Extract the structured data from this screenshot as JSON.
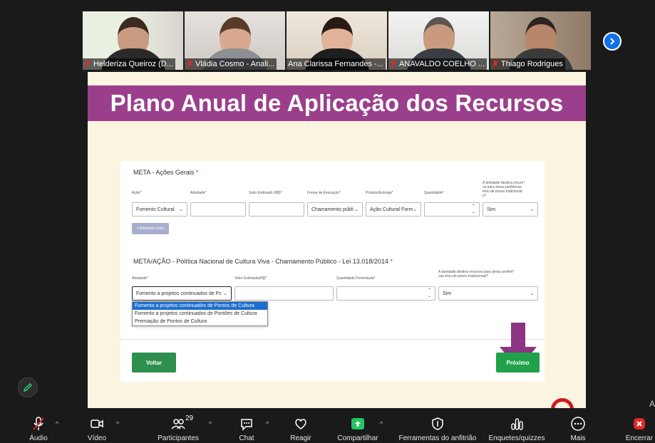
{
  "participants": [
    {
      "name": "Helderiza Queiroz (D..."
    },
    {
      "name": "Vládia Cosmo - Anali..."
    },
    {
      "name": "Ana Clarissa Fernandes -..."
    },
    {
      "name": "ANAVALDO COELHO ..."
    },
    {
      "name": "Thiago Rodrigues"
    }
  ],
  "slide": {
    "title": "Plano Anual de Aplicação dos Recursos",
    "section1": {
      "title": "META - Ações Gerais",
      "required_mark": "*",
      "labels": {
        "acao": "Ação*",
        "atividade": "Atividade*",
        "valor": "Valor Estimado (R$)*",
        "forma": "Forma de Execução*",
        "produto": "Produto/Entrega*",
        "quantidade": "Quantidade*",
        "destina_1": "A atividade destina recurs*",
        "destina_2": "os para áreas periféricas",
        "destina_3": "e/ou de povos tradicional",
        "destina_4": "s?"
      },
      "values": {
        "acao": "Fomento Cultural",
        "forma": "Chamamento públi",
        "produto": "Ação Cultural Form",
        "destina": "Sim"
      },
      "add_button": "+ Adicionar Linha"
    },
    "section2": {
      "title": "META/AÇÃO - Política Nacional de Cultura Viva - Chamamento Público - Lei 13.018/2014",
      "required_mark": "*",
      "labels": {
        "atividade": "Atividade*",
        "valor": "Valor Estimado(R$)*",
        "quantidade": "Quantidade Fomentada*",
        "destina_1": "A atividade destina recursos para áreas periféri*",
        "destina_2": "cas e/ou de povos tradicionais?"
      },
      "values": {
        "atividade": "Fomento a projetos continuados de Pc",
        "destina": "Sim"
      },
      "dropdown_options": [
        "Fomento a projetos continuados de Pontos de Cultura",
        "Fomento a projetos continuados de Pontões de Cultura",
        "Premiação de Pontos de Cultura"
      ]
    },
    "buttons": {
      "back": "Voltar",
      "next": "Próximo"
    }
  },
  "toolbar": {
    "audio": "Áudio",
    "video": "Vídeo",
    "participants": "Participantes",
    "participants_count": "29",
    "chat": "Chat",
    "react": "Reagir",
    "share": "Compartilhar",
    "host_tools": "Ferramentas do anfitrião",
    "polls": "Enquetes/quizzes",
    "more": "Mais",
    "end": "Encerrar"
  },
  "side_text": {
    "line1": "A",
    "line2": "A"
  },
  "colors": {
    "slide_title_bg": "#9b3f8c",
    "arrow": "#8b3484",
    "green_button": "#21a24a",
    "active_speaker": "#2fd17b",
    "zoom_blue": "#0e71eb",
    "share_green": "#23c55e"
  }
}
